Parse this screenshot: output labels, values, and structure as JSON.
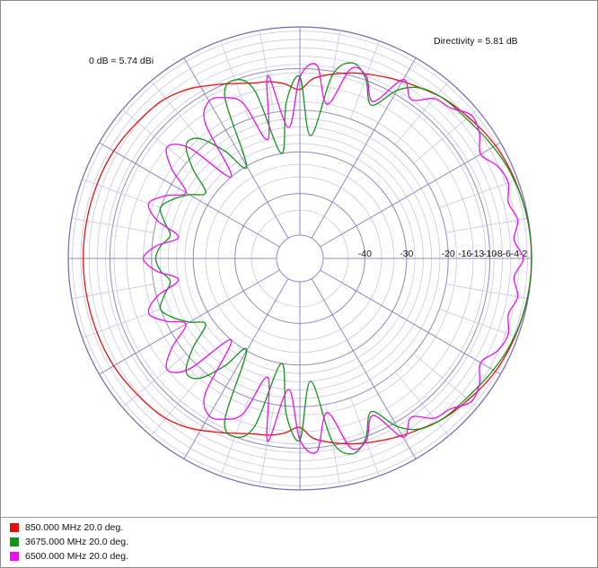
{
  "chart_data": {
    "type": "polar",
    "annotations": {
      "gain_reference": "0 dB = 5.74 dBi",
      "directivity": "Directivity = 5.81 dB"
    },
    "radial_scale": "dB",
    "radial_ticks": [
      "-40",
      "-30",
      "-20",
      "-16",
      "-13",
      "-10",
      "-8",
      "-6",
      "-4",
      "-2"
    ],
    "radial_tick_values": [
      -40,
      -30,
      -20,
      -16,
      -13,
      -10,
      -8,
      -6,
      -4,
      -2
    ],
    "radial_range": [
      -50,
      0
    ],
    "angular_grid_step_deg": 30,
    "grid": true,
    "legend_position": "bottom-left",
    "series": [
      {
        "name": "850.000 MHz 20.0 deg.",
        "color": "#e8120c",
        "theta_deg": [
          0,
          15,
          30,
          45,
          55,
          65,
          75,
          85,
          90,
          95,
          100,
          105,
          115,
          125,
          135,
          150,
          165,
          180,
          195,
          210,
          225,
          235,
          245,
          255,
          260,
          265,
          270,
          275,
          285,
          295,
          305,
          315,
          330,
          345,
          360
        ],
        "r_db": [
          0,
          -0.4,
          -1.4,
          -3.5,
          -5.5,
          -7.5,
          -9.5,
          -12.0,
          -15.0,
          -13.5,
          -12.5,
          -12.0,
          -9.5,
          -6.5,
          -5.0,
          -4.0,
          -3.7,
          -3.6,
          -3.7,
          -4.0,
          -5.0,
          -6.5,
          -9.5,
          -12.0,
          -12.5,
          -13.5,
          -15.0,
          -12.0,
          -9.5,
          -7.5,
          -5.5,
          -3.5,
          -1.4,
          -0.4,
          0
        ]
      },
      {
        "name": "3675.000 MHz 20.0 deg.",
        "color": "#14941a",
        "theta_deg": [
          0,
          8,
          16,
          24,
          32,
          40,
          48,
          55,
          60,
          65,
          70,
          75,
          80,
          85,
          90,
          95,
          100,
          105,
          110,
          115,
          120,
          125,
          130,
          135,
          140,
          145,
          150,
          155,
          160,
          165,
          170,
          175,
          180,
          185,
          190,
          195,
          200,
          205,
          210,
          215,
          220,
          225,
          230,
          235,
          240,
          245,
          250,
          255,
          260,
          265,
          270,
          275,
          280,
          285,
          290,
          295,
          300,
          305,
          312,
          320,
          328,
          336,
          344,
          352,
          360
        ],
        "r_db": [
          0,
          -0.1,
          -0.5,
          -1.2,
          -2.3,
          -3.4,
          -4.0,
          -5.6,
          -9.0,
          -15.0,
          -9.5,
          -7.0,
          -11.0,
          -26.0,
          -12.0,
          -18.0,
          -30.0,
          -14.0,
          -10.0,
          -13.0,
          -30.0,
          -24.0,
          -18.0,
          -17.0,
          -22.0,
          -28.0,
          -25.0,
          -22.0,
          -20.0,
          -22.0,
          -24.0,
          -22.0,
          -21.0,
          -22.0,
          -24.0,
          -22.0,
          -20.0,
          -22.0,
          -25.0,
          -28.0,
          -22.0,
          -17.0,
          -18.0,
          -24.0,
          -30.0,
          -13.0,
          -10.0,
          -14.0,
          -30.0,
          -18.0,
          -12.0,
          -26.0,
          -11.0,
          -7.0,
          -9.5,
          -15.0,
          -9.0,
          -5.6,
          -4.0,
          -3.4,
          -2.3,
          -1.2,
          -0.5,
          -0.1,
          0
        ]
      },
      {
        "name": "6500.000 MHz 20.0 deg.",
        "color": "#ee10ee",
        "theta_deg": [
          0,
          5,
          10,
          15,
          20,
          25,
          30,
          35,
          40,
          45,
          50,
          55,
          60,
          65,
          70,
          75,
          80,
          85,
          90,
          95,
          100,
          105,
          110,
          115,
          120,
          125,
          130,
          135,
          140,
          145,
          150,
          155,
          160,
          165,
          170,
          175,
          180,
          185,
          190,
          195,
          200,
          205,
          210,
          215,
          220,
          225,
          230,
          235,
          240,
          245,
          250,
          255,
          260,
          265,
          270,
          275,
          280,
          285,
          290,
          295,
          300,
          305,
          310,
          315,
          320,
          325,
          330,
          335,
          340,
          345,
          350,
          355,
          360
        ],
        "r_db": [
          -2.0,
          -4.0,
          -2.5,
          -3.8,
          -2.4,
          -3.2,
          -5.5,
          -3.0,
          -2.0,
          -4.5,
          -5.5,
          -9.0,
          -6.0,
          -14.0,
          -9.0,
          -8.5,
          -18.0,
          -9.0,
          -12.0,
          -24.0,
          -11.0,
          -26.0,
          -16.0,
          -13.0,
          -12.0,
          -16.0,
          -30.0,
          -18.0,
          -14.0,
          -18.0,
          -24.0,
          -20.0,
          -17.0,
          -20.0,
          -26.0,
          -21.0,
          -18.0,
          -21.0,
          -26.0,
          -20.0,
          -17.0,
          -20.0,
          -24.0,
          -18.0,
          -14.0,
          -18.0,
          -30.0,
          -16.0,
          -12.0,
          -13.0,
          -16.0,
          -26.0,
          -11.0,
          -24.0,
          -12.0,
          -9.0,
          -18.0,
          -8.5,
          -9.0,
          -14.0,
          -6.0,
          -9.0,
          -5.5,
          -4.5,
          -2.0,
          -3.0,
          -5.5,
          -3.2,
          -2.4,
          -3.8,
          -2.5,
          -4.0,
          -2.0
        ]
      }
    ]
  }
}
